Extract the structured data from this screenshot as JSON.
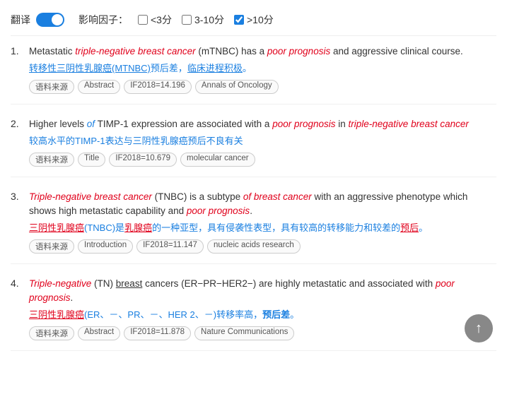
{
  "toolbar": {
    "translate_label": "翻译",
    "filter_label": "影响因子：",
    "options": [
      {
        "label": "<3分",
        "checked": false
      },
      {
        "label": "3-10分",
        "checked": false
      },
      {
        "label": ">10分",
        "checked": true
      }
    ]
  },
  "results": [
    {
      "number": "1.",
      "en_parts": [
        {
          "text": "Metastatic ",
          "style": "normal"
        },
        {
          "text": "triple-negative breast cancer",
          "style": "italic-red"
        },
        {
          "text": " (mTNBC) has a ",
          "style": "normal"
        },
        {
          "text": "poor prognosis",
          "style": "italic-red"
        },
        {
          "text": " and aggressive clinical course.",
          "style": "normal"
        }
      ],
      "zh_parts": [
        {
          "text": "转移性三阴性乳腺癌",
          "style": "underline-blue"
        },
        {
          "text": "(MTNBC)",
          "style": "underline-blue"
        },
        {
          "text": "预后差，",
          "style": "blue"
        },
        {
          "text": "临床进程积极",
          "style": "blue-underline"
        },
        {
          "text": "。",
          "style": "blue"
        }
      ],
      "tags": [
        "语料来源",
        "Abstract",
        "IF2018=14.196",
        "Annals of Oncology"
      ]
    },
    {
      "number": "2.",
      "en_parts": [
        {
          "text": "Higher levels ",
          "style": "normal"
        },
        {
          "text": "of",
          "style": "italic-blue"
        },
        {
          "text": " TIMP-1 expression are associated with a ",
          "style": "normal"
        },
        {
          "text": "poor prognosis",
          "style": "italic-red"
        },
        {
          "text": " in ",
          "style": "normal"
        },
        {
          "text": "triple-negative breast cancer",
          "style": "italic-red"
        }
      ],
      "zh_parts": [
        {
          "text": "较高水平的TIMP-1表达与三阴性乳腺癌预后不良有关",
          "style": "blue"
        }
      ],
      "tags": [
        "语料来源",
        "Title",
        "IF2018=10.679",
        "molecular cancer"
      ]
    },
    {
      "number": "3.",
      "en_parts": [
        {
          "text": "Triple-negative breast cancer",
          "style": "italic-red"
        },
        {
          "text": " (TNBC) is a subtype ",
          "style": "normal"
        },
        {
          "text": "of breast cancer",
          "style": "italic-red"
        },
        {
          "text": " with an aggressive phenotype which shows high metastatic capability and ",
          "style": "normal"
        },
        {
          "text": "poor prognosis",
          "style": "italic-red"
        },
        {
          "text": ".",
          "style": "normal"
        }
      ],
      "zh_parts": [
        {
          "text": "三阴性乳腺癌",
          "style": "underline-red"
        },
        {
          "text": "(TNBC)是",
          "style": "blue"
        },
        {
          "text": "乳腺癌",
          "style": "underline-red"
        },
        {
          "text": "的一种亚型，具有侵袭性表型，具有较高的转移能力和较差的预后。",
          "style": "blue"
        }
      ],
      "tags": [
        "语料来源",
        "Introduction",
        "IF2018=11.147",
        "nucleic acids research"
      ]
    },
    {
      "number": "4.",
      "en_parts": [
        {
          "text": "Triple-negative",
          "style": "italic-red"
        },
        {
          "text": " (TN) ",
          "style": "normal"
        },
        {
          "text": "breast",
          "style": "underline-normal"
        },
        {
          "text": " cancers (ER−PR−HER2−) are highly metastatic and associated with ",
          "style": "normal"
        },
        {
          "text": "poor prognosis",
          "style": "italic-red"
        },
        {
          "text": ".",
          "style": "normal"
        }
      ],
      "zh_parts": [
        {
          "text": "三阴性乳腺癌",
          "style": "underline-red"
        },
        {
          "text": "(ER、－、PR、－、HER 2、－)转移率高，",
          "style": "blue"
        },
        {
          "text": "预后差",
          "style": "blue-bold"
        },
        {
          "text": "。",
          "style": "blue"
        }
      ],
      "tags": [
        "语料来源",
        "Abstract",
        "IF2018=11.878",
        "Nature Communications"
      ]
    }
  ],
  "scroll_top_icon": "↑"
}
